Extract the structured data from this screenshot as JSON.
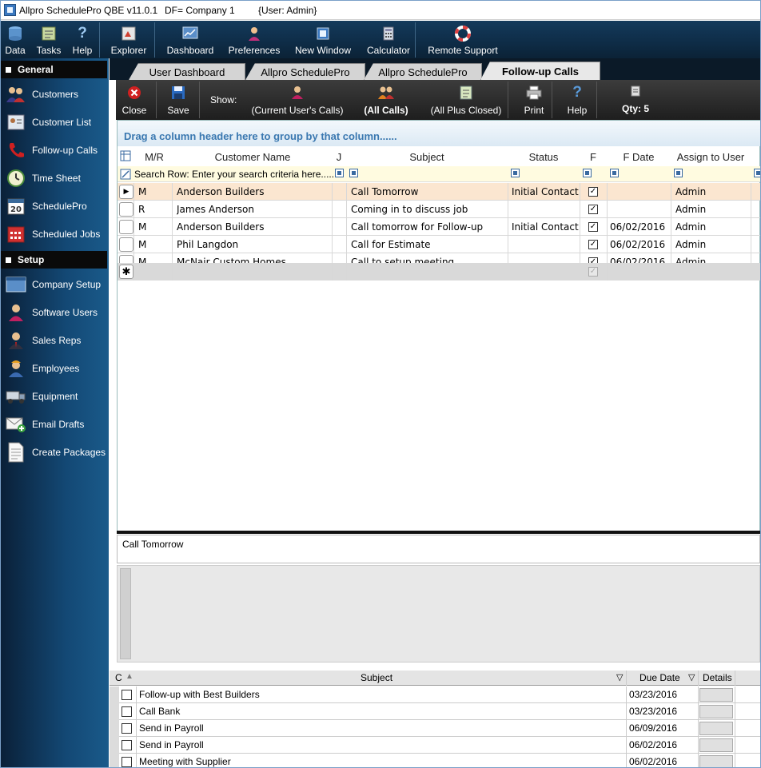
{
  "titlebar": {
    "app_title": "Allpro SchedulePro QBE  v11.0.1",
    "db_file": "DF= Company 1",
    "user": "{User: Admin}"
  },
  "toolbar": {
    "data": "Data",
    "tasks": "Tasks",
    "help": "Help",
    "explorer": "Explorer",
    "dashboard": "Dashboard",
    "preferences": "Preferences",
    "new_window": "New Window",
    "calculator": "Calculator",
    "remote_support": "Remote Support"
  },
  "sidebar": {
    "general_header": "General",
    "setup_header": "Setup",
    "general_items": [
      "Customers",
      "Customer List",
      "Follow-up Calls",
      "Time Sheet",
      "SchedulePro",
      "Scheduled Jobs"
    ],
    "setup_items": [
      "Company Setup",
      "Software Users",
      "Sales Reps",
      "Employees",
      "Equipment",
      "Email Drafts",
      "Create Packages"
    ]
  },
  "tabs": [
    "User Dashboard",
    "Allpro SchedulePro",
    "Allpro SchedulePro",
    "Follow-up Calls"
  ],
  "form_toolbar": {
    "close": "Close",
    "save": "Save",
    "show": "Show:",
    "current_users_calls": "(Current User's Calls)",
    "all_calls": "(All Calls)",
    "all_plus_closed": "(All Plus Closed)",
    "print": "Print",
    "help": "Help",
    "qty": "Qty: 5"
  },
  "grid": {
    "group_hint": "Drag a column header here to group by that column......",
    "columns": [
      "M/R",
      "Customer Name",
      "J",
      "Subject",
      "Status",
      "F",
      "F Date",
      "Assign to User"
    ],
    "search_hint": "Search Row: Enter your search criteria here......",
    "rows": [
      {
        "mr": "M",
        "customer": "Anderson Builders",
        "subject": "Call Tomorrow",
        "status": "Initial Contact",
        "fdate": "",
        "user": "Admin"
      },
      {
        "mr": "R",
        "customer": "James Anderson",
        "subject": "Coming in to discuss job",
        "status": "",
        "fdate": "",
        "user": "Admin"
      },
      {
        "mr": "M",
        "customer": "Anderson Builders",
        "subject": "Call tomorrow for Follow-up",
        "status": "Initial Contact",
        "fdate": "06/02/2016",
        "user": "Admin"
      },
      {
        "mr": "M",
        "customer": "Phil Langdon",
        "subject": "Call for Estimate",
        "status": "",
        "fdate": "06/02/2016",
        "user": "Admin"
      },
      {
        "mr": "M",
        "customer": "McNair Custom Homes",
        "subject": "Call to setup meeting",
        "status": "",
        "fdate": "06/02/2016",
        "user": "Admin"
      }
    ]
  },
  "notes": {
    "text": "Call Tomorrow"
  },
  "tasks": {
    "col_c": "C",
    "col_subject": "Subject",
    "col_due": "Due Date",
    "col_details": "Details",
    "rows": [
      {
        "subject": "Follow-up with Best Builders",
        "due": "03/23/2016"
      },
      {
        "subject": "Call Bank",
        "due": "03/23/2016"
      },
      {
        "subject": "Send in Payroll",
        "due": "06/09/2016"
      },
      {
        "subject": "Send in Payroll",
        "due": "06/02/2016"
      },
      {
        "subject": "Meeting with Supplier",
        "due": "06/02/2016"
      }
    ]
  },
  "colors": {
    "toolbar": "#0e2c46",
    "sidebar": "#134874",
    "selected_row": "#fbe6d0",
    "group_text": "#3a78b0"
  }
}
